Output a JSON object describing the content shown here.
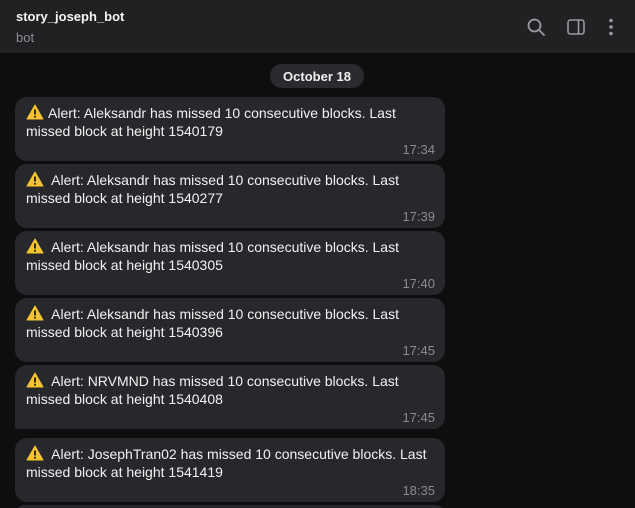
{
  "header": {
    "title": "story_joseph_bot",
    "subtitle": "bot",
    "icons": [
      "search-icon",
      "sidebar-toggle-icon",
      "more-vertical-icon"
    ]
  },
  "date_separator": "October 18",
  "messages": [
    {
      "text": "Alert: Aleksandr has missed 10 consecutive blocks. Last missed block at height 1540179",
      "time": "17:34"
    },
    {
      "text": "Alert: Aleksandr has missed 10 consecutive blocks. Last missed block at height 1540277",
      "time": "17:39"
    },
    {
      "text": "Alert: Aleksandr has missed 10 consecutive blocks. Last missed block at height 1540305",
      "time": "17:40"
    },
    {
      "text": "Alert: Aleksandr has missed 10 consecutive blocks. Last missed block at height 1540396",
      "time": "17:45"
    },
    {
      "text": "Alert: NRVMND has missed 10 consecutive blocks. Last missed block at height 1540408",
      "time": "17:45"
    },
    {
      "text": "Alert: JosephTran02 has missed 10 consecutive blocks. Last missed block at height 1541419",
      "time": "18:35"
    }
  ],
  "colors": {
    "background": "#0e0e0f",
    "header": "#212123",
    "bubble": "#27282b",
    "time": "#8b8c90",
    "warning": "#f4c430"
  }
}
